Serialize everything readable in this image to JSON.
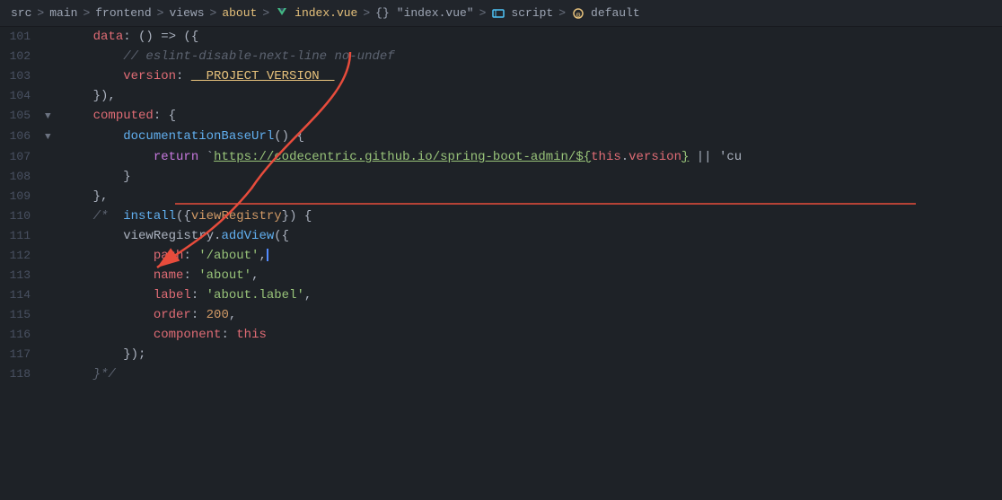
{
  "breadcrumb": {
    "parts": [
      {
        "label": "src",
        "type": "plain"
      },
      {
        "label": ">",
        "type": "sep"
      },
      {
        "label": "main",
        "type": "plain"
      },
      {
        "label": ">",
        "type": "sep"
      },
      {
        "label": "frontend",
        "type": "plain"
      },
      {
        "label": ">",
        "type": "sep"
      },
      {
        "label": "views",
        "type": "plain"
      },
      {
        "label": ">",
        "type": "sep"
      },
      {
        "label": "about",
        "type": "about"
      },
      {
        "label": ">",
        "type": "sep"
      },
      {
        "label": "index.vue",
        "type": "index"
      },
      {
        "label": ">",
        "type": "sep"
      },
      {
        "label": "{}",
        "type": "plain"
      },
      {
        "label": "\"index.vue\"",
        "type": "plain"
      },
      {
        "label": ">",
        "type": "sep"
      },
      {
        "label": "script",
        "type": "plain"
      },
      {
        "label": ">",
        "type": "sep"
      },
      {
        "label": "default",
        "type": "plain"
      }
    ]
  },
  "lines": [
    {
      "number": "101",
      "fold": "",
      "indent": "    ",
      "tokens": [
        {
          "text": "data",
          "class": "t-property"
        },
        {
          "text": ": () => ({",
          "class": "t-punct"
        }
      ]
    },
    {
      "number": "102",
      "fold": "",
      "indent": "        ",
      "tokens": [
        {
          "text": "// eslint-disable-next-line no-undef",
          "class": "t-comment"
        }
      ]
    },
    {
      "number": "103",
      "fold": "",
      "indent": "        ",
      "tokens": [
        {
          "text": "version",
          "class": "t-property"
        },
        {
          "text": ": ",
          "class": "t-punct"
        },
        {
          "text": "__PROJECT_VERSION__",
          "class": "t-version"
        }
      ]
    },
    {
      "number": "104",
      "fold": "",
      "indent": "    ",
      "tokens": [
        {
          "text": "}),",
          "class": "t-punct"
        }
      ]
    },
    {
      "number": "105",
      "fold": "▼",
      "indent": "    ",
      "tokens": [
        {
          "text": "computed",
          "class": "t-property"
        },
        {
          "text": ": {",
          "class": "t-punct"
        }
      ]
    },
    {
      "number": "106",
      "fold": "▼",
      "indent": "        ",
      "tokens": [
        {
          "text": "documentationBaseUrl",
          "class": "t-func"
        },
        {
          "text": "() {",
          "class": "t-punct"
        }
      ]
    },
    {
      "number": "107",
      "fold": "",
      "indent": "            ",
      "tokens": [
        {
          "text": "return",
          "class": "t-keyword"
        },
        {
          "text": " `",
          "class": "t-punct"
        },
        {
          "text": "https://codecentric.github.io/spring-boot-admin/${",
          "class": "t-url"
        },
        {
          "text": "this",
          "class": "t-this"
        },
        {
          "text": ".",
          "class": "t-punct"
        },
        {
          "text": "version",
          "class": "t-property"
        },
        {
          "text": "}",
          "class": "t-url"
        },
        {
          "text": " || 'cu",
          "class": "t-default"
        }
      ]
    },
    {
      "number": "108",
      "fold": "",
      "indent": "        ",
      "tokens": [
        {
          "text": "}",
          "class": "t-punct"
        }
      ]
    },
    {
      "number": "109",
      "fold": "",
      "indent": "    ",
      "tokens": [
        {
          "text": "},",
          "class": "t-punct"
        }
      ]
    },
    {
      "number": "110",
      "fold": "",
      "indent": "    ",
      "tokens": [
        {
          "text": "/*  ",
          "class": "t-comment"
        },
        {
          "text": "install",
          "class": "t-func"
        },
        {
          "text": "({",
          "class": "t-punct"
        },
        {
          "text": "viewRegistry",
          "class": "t-param"
        },
        {
          "text": "}) {",
          "class": "t-punct"
        }
      ]
    },
    {
      "number": "111",
      "fold": "",
      "indent": "        ",
      "tokens": [
        {
          "text": "viewRegistry",
          "class": "t-default"
        },
        {
          "text": ".",
          "class": "t-punct"
        },
        {
          "text": "addView",
          "class": "t-method"
        },
        {
          "text": "({",
          "class": "t-punct"
        }
      ]
    },
    {
      "number": "112",
      "fold": "",
      "indent": "            ",
      "tokens": [
        {
          "text": "path",
          "class": "t-property"
        },
        {
          "text": ": ",
          "class": "t-punct"
        },
        {
          "text": "'/about'",
          "class": "t-string"
        },
        {
          "text": ",",
          "class": "t-punct"
        }
      ]
    },
    {
      "number": "113",
      "fold": "",
      "indent": "            ",
      "tokens": [
        {
          "text": "name",
          "class": "t-property"
        },
        {
          "text": ": ",
          "class": "t-punct"
        },
        {
          "text": "'about'",
          "class": "t-string"
        },
        {
          "text": ",",
          "class": "t-punct"
        }
      ]
    },
    {
      "number": "114",
      "fold": "",
      "indent": "            ",
      "tokens": [
        {
          "text": "label",
          "class": "t-property"
        },
        {
          "text": ": ",
          "class": "t-punct"
        },
        {
          "text": "'about.label'",
          "class": "t-string"
        },
        {
          "text": ",",
          "class": "t-punct"
        }
      ]
    },
    {
      "number": "115",
      "fold": "",
      "indent": "            ",
      "tokens": [
        {
          "text": "order",
          "class": "t-property"
        },
        {
          "text": ": ",
          "class": "t-punct"
        },
        {
          "text": "200",
          "class": "t-number"
        },
        {
          "text": ",",
          "class": "t-punct"
        }
      ]
    },
    {
      "number": "116",
      "fold": "",
      "indent": "            ",
      "tokens": [
        {
          "text": "component",
          "class": "t-property"
        },
        {
          "text": ": ",
          "class": "t-punct"
        },
        {
          "text": "this",
          "class": "t-this"
        }
      ]
    },
    {
      "number": "117",
      "fold": "",
      "indent": "        ",
      "tokens": [
        {
          "text": "});",
          "class": "t-punct"
        }
      ]
    },
    {
      "number": "118",
      "fold": "",
      "indent": "    ",
      "tokens": [
        {
          "text": "}*/",
          "class": "t-comment"
        }
      ]
    }
  ]
}
